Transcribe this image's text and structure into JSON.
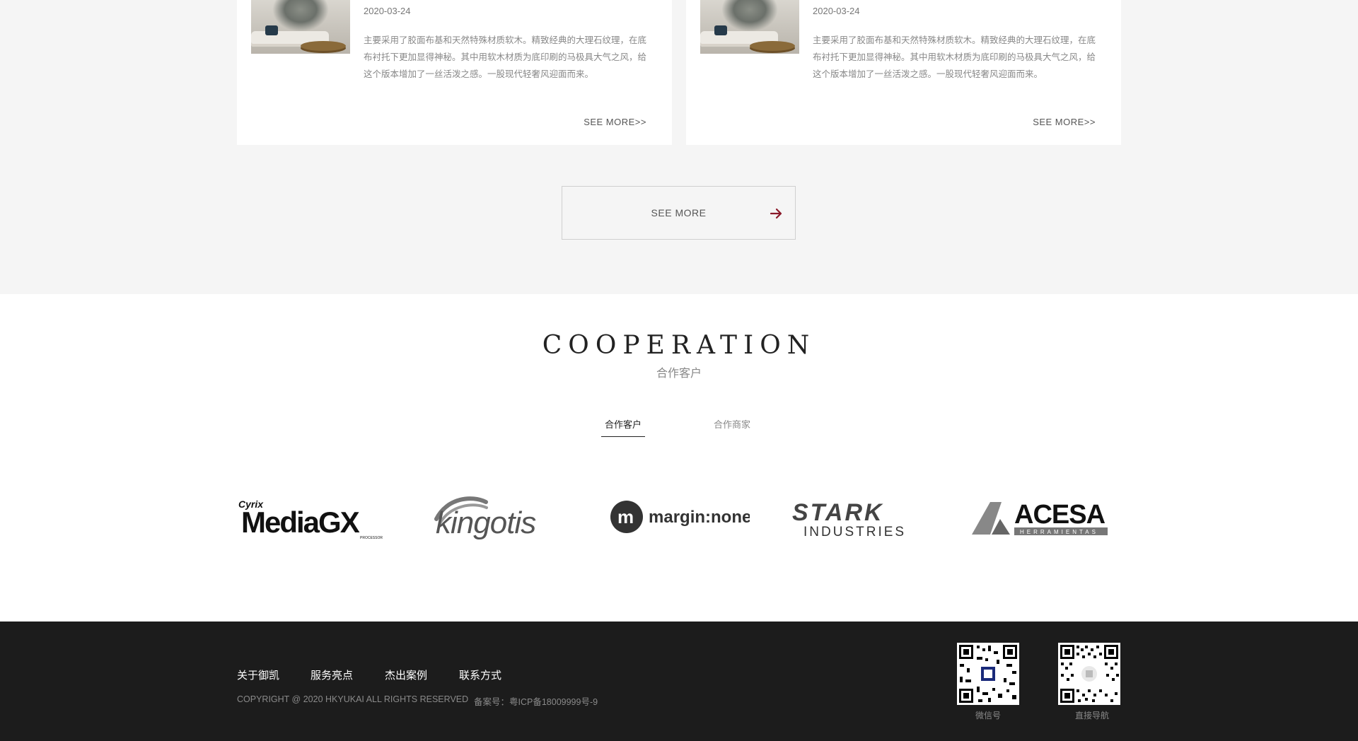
{
  "news": [
    {
      "date": "2020-03-24",
      "summary": "主要采用了胶面布基和天然特殊材质软木。精致经典的大理石纹理，在底布衬托下更加显得神秘。其中用软木材质为底印刷的马极具大气之风，给这个版本增加了一丝活泼之感。一股现代轻奢风迎面而来。",
      "more": "SEE MORE>>"
    },
    {
      "date": "2020-03-24",
      "summary": "主要采用了胶面布基和天然特殊材质软木。精致经典的大理石纹理，在底布衬托下更加显得神秘。其中用软木材质为底印刷的马极具大气之风，给这个版本增加了一丝活泼之感。一股现代轻奢风迎面而来。",
      "more": "SEE MORE>>"
    }
  ],
  "see_more": {
    "label": "SEE MORE",
    "arrow_color": "#8b1a2b"
  },
  "cooperation": {
    "title": "COOPERATION",
    "subtitle": "合作客户",
    "tabs": [
      {
        "label": "合作客户",
        "active": true
      },
      {
        "label": "合作商家",
        "active": false
      }
    ],
    "logos": [
      {
        "name": "Cyrix MediaGX",
        "small": "Cyrix",
        "main": "MediaGX",
        "sub": "PROCESSOR"
      },
      {
        "name": "Kingotis",
        "main": "kingotis"
      },
      {
        "name": "margin:none",
        "main": "margin:none",
        "mark": "m"
      },
      {
        "name": "Stark Industries",
        "main": "STARK",
        "sub": "INDUSTRIES"
      },
      {
        "name": "Acesa",
        "main": "ACESA",
        "sub": "HERRAMIENTAS"
      }
    ]
  },
  "footer": {
    "links": [
      "关于御凯",
      "服务亮点",
      "杰出案例",
      "联系方式"
    ],
    "copyright": "COPYRIGHT @ 2020 HKYUKAI ALL RIGHTS RESERVED",
    "icp": "备案号：粤ICP备18009999号-9",
    "qr": [
      {
        "caption": "微信号"
      },
      {
        "caption": "直接导航"
      }
    ]
  }
}
